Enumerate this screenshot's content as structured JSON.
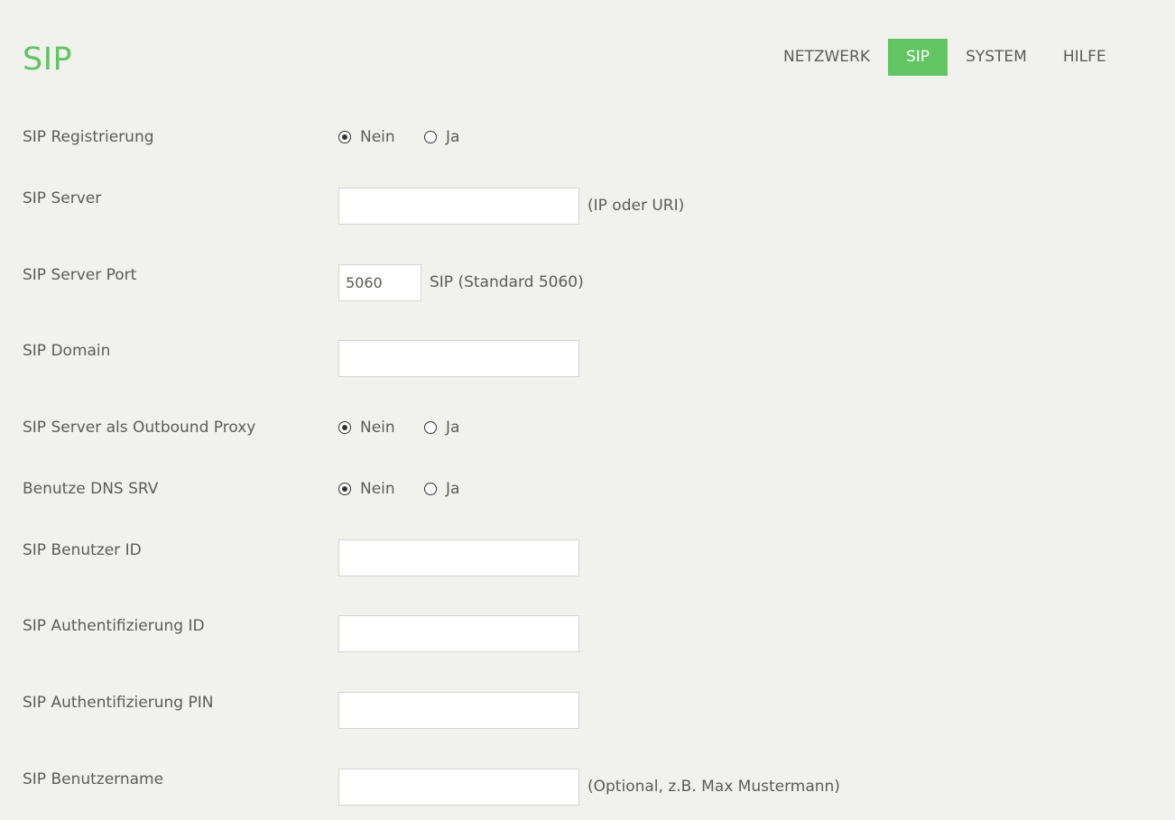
{
  "page": {
    "title": "SIP"
  },
  "nav": {
    "items": [
      {
        "label": "NETZWERK",
        "active": false
      },
      {
        "label": "SIP",
        "active": true
      },
      {
        "label": "SYSTEM",
        "active": false
      },
      {
        "label": "HILFE",
        "active": false
      }
    ]
  },
  "colors": {
    "accent": "#62c462",
    "background": "#f1f1ed",
    "text": "#5b5b58"
  },
  "form": {
    "sip_registration": {
      "label": "SIP Registrierung",
      "option_no": "Nein",
      "option_yes": "Ja",
      "selected": "Nein"
    },
    "sip_server": {
      "label": "SIP Server",
      "value": "",
      "hint": "(IP oder URI)"
    },
    "sip_server_port": {
      "label": "SIP Server Port",
      "value": "5060",
      "hint": "SIP (Standard 5060)"
    },
    "sip_domain": {
      "label": "SIP Domain",
      "value": ""
    },
    "outbound_proxy": {
      "label": "SIP Server als Outbound Proxy",
      "option_no": "Nein",
      "option_yes": "Ja",
      "selected": "Nein"
    },
    "dns_srv": {
      "label": "Benutze DNS SRV",
      "option_no": "Nein",
      "option_yes": "Ja",
      "selected": "Nein"
    },
    "sip_user_id": {
      "label": "SIP Benutzer ID",
      "value": ""
    },
    "sip_auth_id": {
      "label": "SIP Authentifizierung ID",
      "value": ""
    },
    "sip_auth_pin": {
      "label": "SIP Authentifizierung PIN",
      "value": ""
    },
    "sip_username": {
      "label": "SIP Benutzername",
      "value": "",
      "hint": "(Optional, z.B. Max Mustermann)"
    }
  }
}
